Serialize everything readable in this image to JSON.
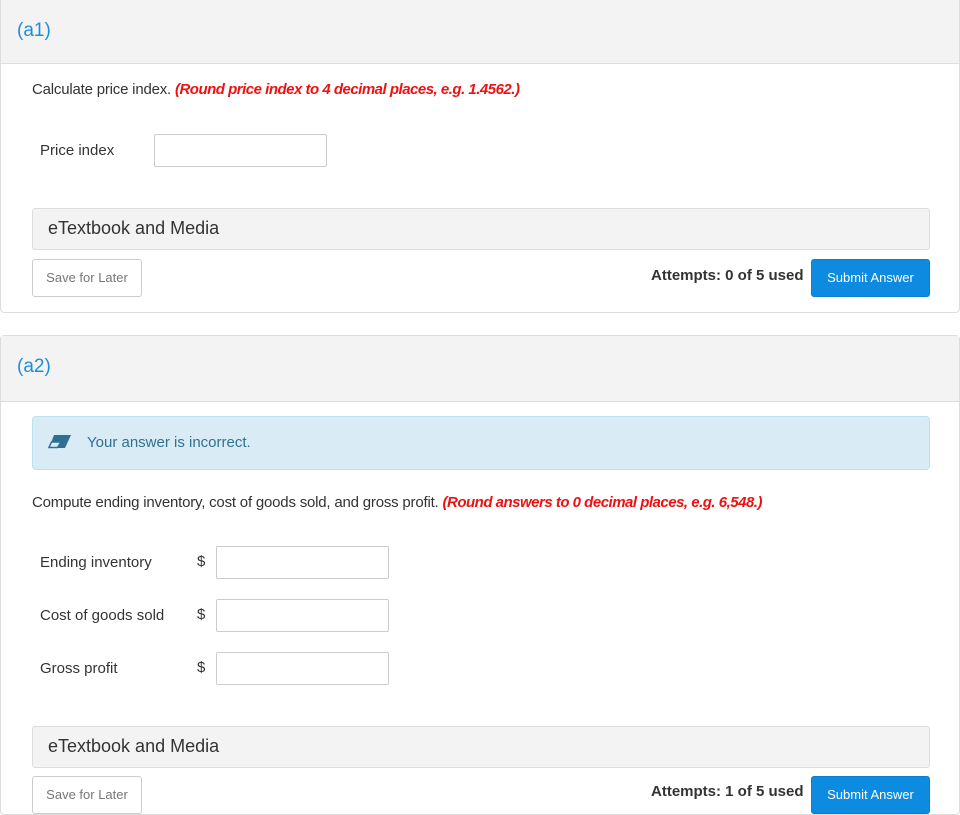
{
  "parts": [
    {
      "label": "(a1)",
      "question": "Calculate price index.",
      "hint": "(Round price index to 4 decimal places, e.g. 1.4562.)",
      "fields": [
        {
          "label": "Price index",
          "value": "",
          "prefix": ""
        }
      ],
      "media_label": "eTextbook and Media",
      "save_label": "Save for Later",
      "attempts": "Attempts: 0 of 5 used",
      "submit_label": "Submit Answer"
    },
    {
      "label": "(a2)",
      "feedback": {
        "icon": "eraser-icon",
        "message": "Your answer is incorrect."
      },
      "question": "Compute ending inventory, cost of goods sold, and gross profit.",
      "hint": "(Round answers to 0 decimal places, e.g. 6,548.)",
      "fields": [
        {
          "label": "Ending inventory",
          "value": "",
          "prefix": "$"
        },
        {
          "label": "Cost of goods sold",
          "value": "",
          "prefix": "$"
        },
        {
          "label": "Gross profit",
          "value": "",
          "prefix": "$"
        }
      ],
      "media_label": "eTextbook and Media",
      "save_label": "Save for Later",
      "attempts": "Attempts: 1 of 5 used",
      "submit_label": "Submit Answer"
    }
  ],
  "colors": {
    "part_label": "#1f8ed8",
    "hint": "#ee1111",
    "submit": "#0c8be0",
    "alert_bg": "#d9ecf5",
    "alert_text": "#31708f"
  }
}
